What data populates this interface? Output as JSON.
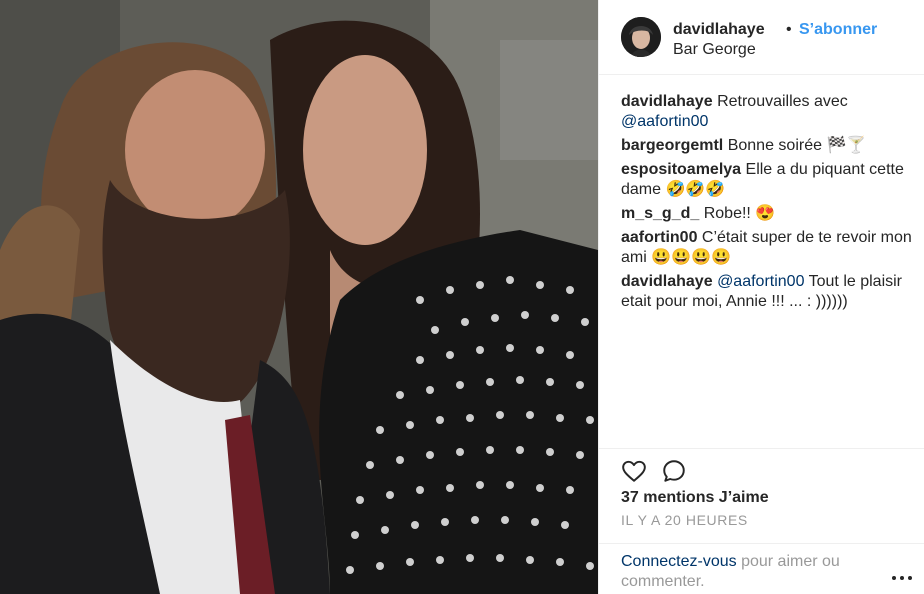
{
  "header": {
    "username": "davidlahaye",
    "separator": "•",
    "follow_label": "S’abonner",
    "location": "Bar George"
  },
  "comments": [
    {
      "user": "davidlahaye",
      "text": "Retrouvailles avec ",
      "mention": "@aafortin00",
      "tail": ""
    },
    {
      "user": "bargeorgemtl",
      "text": "Bonne soirée 🏁🍸",
      "mention": "",
      "tail": ""
    },
    {
      "user": "espositoamelya",
      "text": "Elle a du piquant cette dame 🤣🤣🤣",
      "mention": "",
      "tail": ""
    },
    {
      "user": "m_s_g_d_",
      "text": "Robe!! 😍",
      "mention": "",
      "tail": ""
    },
    {
      "user": "aafortin00",
      "text": "C’était super de te revoir mon ami 😃😃😃😃",
      "mention": "",
      "tail": ""
    },
    {
      "user": "davidlahaye",
      "text": "",
      "mention": "@aafortin00",
      "tail": " Tout le plaisir etait pour moi, Annie !!! ... : ))))))"
    }
  ],
  "actions": {
    "like_icon": "heart-icon",
    "comment_icon": "comment-icon"
  },
  "likes_label": "37 mentions J’aime",
  "timestamp": "IL Y A 20 HEURES",
  "login": {
    "link_text": "Connectez-vous",
    "rest_text": " pour aimer ou commenter."
  },
  "more_icon": "more-options-icon",
  "colors": {
    "link": "#3897f0",
    "mention": "#003569",
    "muted": "#999999",
    "text": "#262626"
  }
}
